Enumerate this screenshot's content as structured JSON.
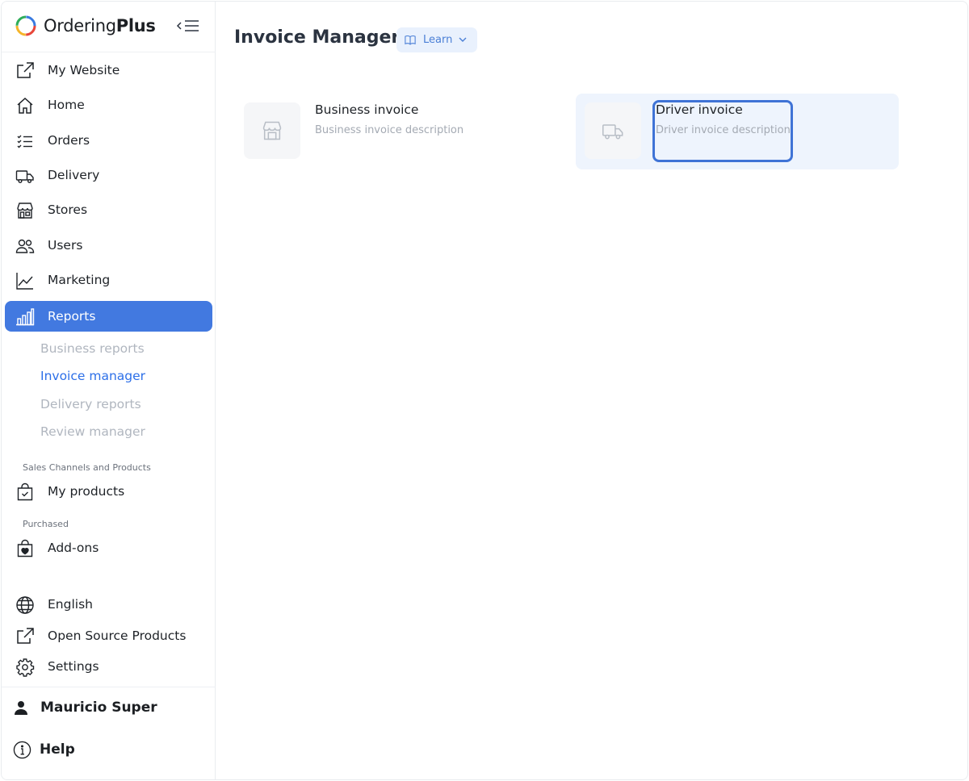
{
  "app": {
    "brand_regular": "Ordering",
    "brand_bold": "Plus",
    "colors": {
      "accent": "#4279e0",
      "active_sub": "#2c6fe8",
      "focus": "#3f73d6"
    }
  },
  "sidebar": {
    "items": [
      {
        "label": "My Website",
        "icon": "external-link-icon"
      },
      {
        "label": "Home",
        "icon": "home-icon"
      },
      {
        "label": "Orders",
        "icon": "list-check-icon"
      },
      {
        "label": "Delivery",
        "icon": "truck-icon"
      },
      {
        "label": "Stores",
        "icon": "shop-icon"
      },
      {
        "label": "Users",
        "icon": "people-icon"
      },
      {
        "label": "Marketing",
        "icon": "graph-up-icon"
      },
      {
        "label": "Reports",
        "icon": "bar-chart-icon",
        "active": true
      }
    ],
    "reports_sub": [
      {
        "label": "Business reports"
      },
      {
        "label": "Invoice manager",
        "current": true
      },
      {
        "label": "Delivery reports"
      },
      {
        "label": "Review manager"
      }
    ],
    "section_sales": "Sales Channels and Products",
    "my_products": "My products",
    "section_purchased": "Purchased",
    "addons": "Add-ons",
    "language": "English",
    "open_source": "Open Source Products",
    "settings": "Settings",
    "user_name": "Mauricio Super",
    "help": "Help"
  },
  "main": {
    "title": "Invoice Manager",
    "learn_label": "Learn",
    "cards": [
      {
        "title": "Business invoice",
        "description": "Business invoice description",
        "icon": "shop-icon"
      },
      {
        "title": "Driver invoice",
        "description": "Driver invoice description",
        "icon": "truck-icon",
        "highlighted": true
      }
    ]
  }
}
